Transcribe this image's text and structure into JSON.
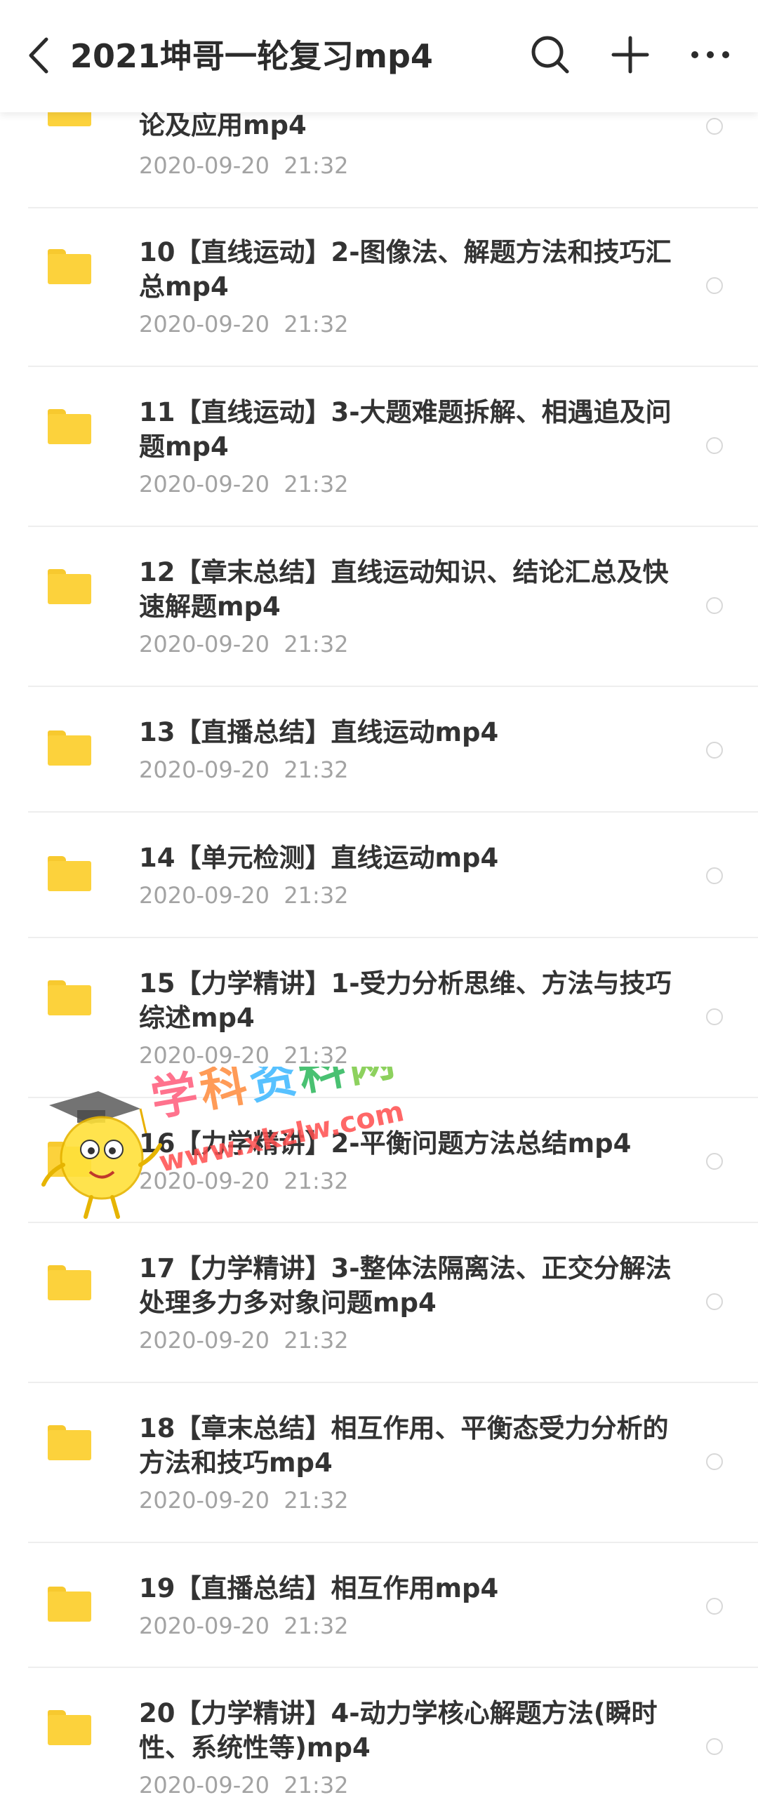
{
  "header": {
    "title": "2021坤哥一轮复习mp4"
  },
  "items": [
    {
      "name": "论及应用mp4",
      "date": "2020-09-20  21:32"
    },
    {
      "name": "10【直线运动】2-图像法、解题方法和技巧汇总mp4",
      "date": "2020-09-20  21:32"
    },
    {
      "name": "11【直线运动】3-大题难题拆解、相遇追及问题mp4",
      "date": "2020-09-20  21:32"
    },
    {
      "name": "12【章末总结】直线运动知识、结论汇总及快速解题mp4",
      "date": "2020-09-20  21:32"
    },
    {
      "name": "13【直播总结】直线运动mp4",
      "date": "2020-09-20  21:32"
    },
    {
      "name": "14【单元检测】直线运动mp4",
      "date": "2020-09-20  21:32"
    },
    {
      "name": "15【力学精讲】1-受力分析思维、方法与技巧综述mp4",
      "date": "2020-09-20  21:32"
    },
    {
      "name": "16【力学精讲】2-平衡问题方法总结mp4",
      "date": "2020-09-20  21:32"
    },
    {
      "name": "17【力学精讲】3-整体法隔离法、正交分解法处理多力多对象问题mp4",
      "date": "2020-09-20  21:32"
    },
    {
      "name": "18【章末总结】相互作用、平衡态受力分析的方法和技巧mp4",
      "date": "2020-09-20  21:32"
    },
    {
      "name": "19【直播总结】相互作用mp4",
      "date": "2020-09-20  21:32"
    },
    {
      "name": "20【力学精讲】4-动力学核心解题方法(瞬时性、系统性等)mp4",
      "date": "2020-09-20  21:32"
    }
  ],
  "watermark": {
    "text": "学科资料网",
    "url": "www.xkzlw.com"
  },
  "icons": {
    "back": "back-arrow-icon",
    "search": "search-icon",
    "add": "plus-icon",
    "more": "more-dots-icon",
    "folder": "folder-icon",
    "select": "radio-circle-icon"
  },
  "colors": {
    "folder": "#fcd23c",
    "title": "#2b2b2b",
    "date": "#a3a3a3",
    "radio": "#d8d8d8"
  }
}
